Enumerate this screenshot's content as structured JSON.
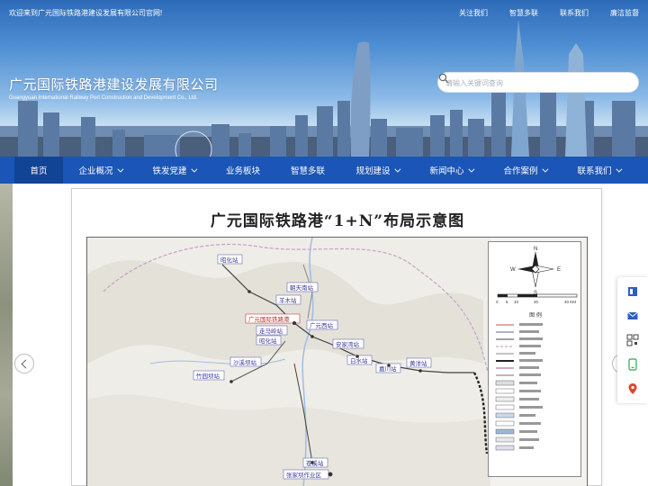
{
  "topbar": {
    "welcome": "欢迎来到广元国际铁路港建设发展有限公司官网!",
    "links": [
      "关注我们",
      "智慧多联",
      "联系我们",
      "廉洁监督"
    ]
  },
  "brand": {
    "name_cn": "广元国际铁路港建设发展有限公司",
    "name_en": "Guangyuan International Railway Port Construction and Development Co., Ltd."
  },
  "search": {
    "placeholder": "请输入关键词查询"
  },
  "nav": [
    {
      "label": "首页",
      "active": true,
      "has_dropdown": false
    },
    {
      "label": "企业概况",
      "active": false,
      "has_dropdown": true
    },
    {
      "label": "铁发党建",
      "active": false,
      "has_dropdown": true
    },
    {
      "label": "业务板块",
      "active": false,
      "has_dropdown": false
    },
    {
      "label": "智慧多联",
      "active": false,
      "has_dropdown": false
    },
    {
      "label": "规划建设",
      "active": false,
      "has_dropdown": true
    },
    {
      "label": "新闻中心",
      "active": false,
      "has_dropdown": true
    },
    {
      "label": "合作案例",
      "active": false,
      "has_dropdown": true
    },
    {
      "label": "联系我们",
      "active": false,
      "has_dropdown": true
    }
  ],
  "slide": {
    "title": "广元国际铁路港“1+N”布局示意图",
    "stations": [
      "昭化站",
      "朝天南站",
      "羊木站",
      "广元国际铁路港",
      "走马岭站",
      "广元西站",
      "昭化站",
      "安家湾站",
      "沙溪坝站",
      "白水站",
      "嘉川站",
      "黄洋站",
      "竹园坝站",
      "苍溪站",
      "张家坝作业区"
    ],
    "legend_title": "图 例",
    "scale_labels": [
      "0",
      "5",
      "10",
      "20",
      "40 KM"
    ],
    "compass": [
      "N",
      "S",
      "W",
      "E"
    ]
  },
  "side_tools": [
    "book-icon",
    "mail-icon",
    "qrcode-icon",
    "phone-icon",
    "location-icon"
  ],
  "colors": {
    "nav_bg": "#1a55b7",
    "nav_active": "#114494",
    "station_label": "#3a3a9c"
  }
}
